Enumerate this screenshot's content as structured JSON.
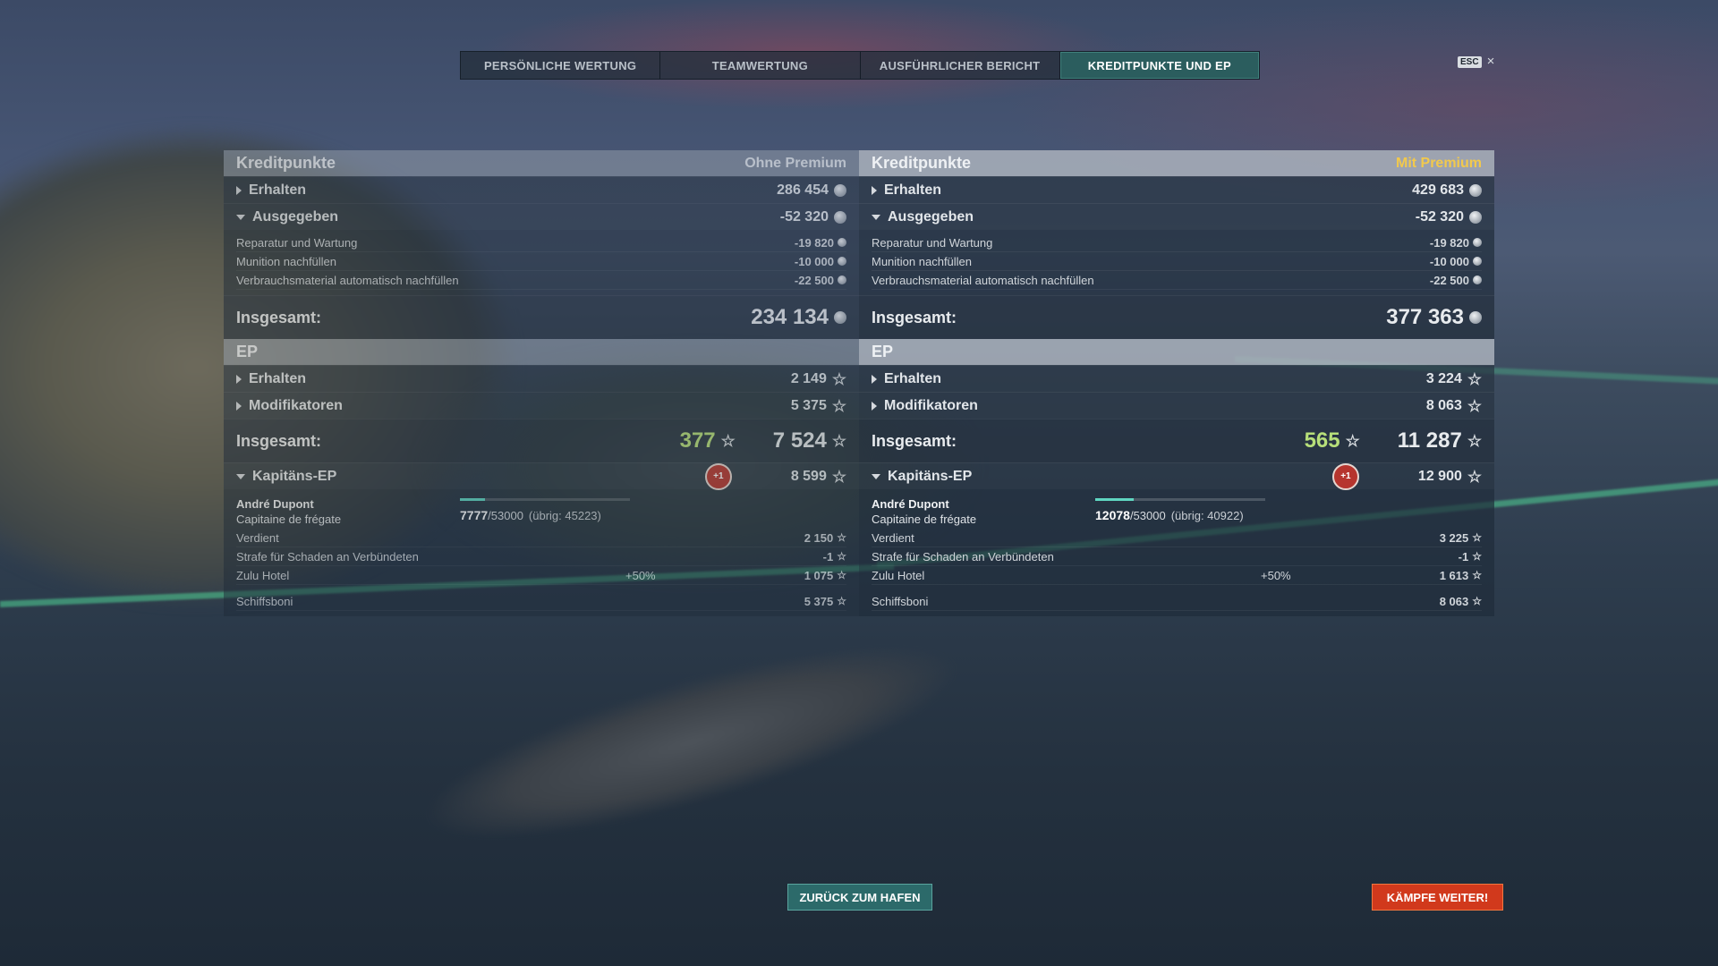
{
  "tabs": [
    {
      "label": "PERSÖNLICHE WERTUNG"
    },
    {
      "label": "TEAMWERTUNG"
    },
    {
      "label": "AUSFÜHRLICHER BERICHT"
    },
    {
      "label": "KREDITPUNKTE UND EP"
    }
  ],
  "esc": {
    "key": "ESC",
    "close": "×"
  },
  "left": {
    "credits_title": "Kreditpunkte",
    "premium_label": "Ohne Premium",
    "earned": {
      "label": "Erhalten",
      "value": "286 454"
    },
    "spent": {
      "label": "Ausgegeben",
      "value": "-52 320"
    },
    "spent_items": [
      {
        "label": "Reparatur und Wartung",
        "value": "-19 820"
      },
      {
        "label": "Munition nachfüllen",
        "value": "-10 000"
      },
      {
        "label": "Verbrauchsmaterial automatisch nachfüllen",
        "value": "-22 500"
      }
    ],
    "credits_total": {
      "label": "Insgesamt:",
      "value": "234 134"
    },
    "xp_title": "EP",
    "xp_earned": {
      "label": "Erhalten",
      "value": "2 149"
    },
    "xp_mods": {
      "label": "Modifikatoren",
      "value": "5 375"
    },
    "xp_total": {
      "label": "Insgesamt:",
      "free": "377",
      "value": "7 524"
    },
    "captain_xp": {
      "label": "Kapitäns-EP",
      "badge": "+1",
      "value": "8 599"
    },
    "captain": {
      "name": "André Dupont",
      "rank": "Capitaine de frégate",
      "progress_current": "7777",
      "progress_max": "/53000",
      "progress_rest": "(übrig: 45223)",
      "progress_fraction": 0.147
    },
    "captain_items": [
      {
        "label": "Verdient",
        "mid": "",
        "value": "2 150"
      },
      {
        "label": "Strafe für Schaden an Verbündeten",
        "mid": "",
        "value": "-1"
      },
      {
        "label": "Zulu Hotel",
        "mid": "+50%",
        "value": "1 075"
      }
    ],
    "ship_bonus": {
      "label": "Schiffsboni",
      "value": "5 375"
    }
  },
  "right": {
    "credits_title": "Kreditpunkte",
    "premium_label": "Mit Premium",
    "earned": {
      "label": "Erhalten",
      "value": "429 683"
    },
    "spent": {
      "label": "Ausgegeben",
      "value": "-52 320"
    },
    "spent_items": [
      {
        "label": "Reparatur und Wartung",
        "value": "-19 820"
      },
      {
        "label": "Munition nachfüllen",
        "value": "-10 000"
      },
      {
        "label": "Verbrauchsmaterial automatisch nachfüllen",
        "value": "-22 500"
      }
    ],
    "credits_total": {
      "label": "Insgesamt:",
      "value": "377 363"
    },
    "xp_title": "EP",
    "xp_earned": {
      "label": "Erhalten",
      "value": "3 224"
    },
    "xp_mods": {
      "label": "Modifikatoren",
      "value": "8 063"
    },
    "xp_total": {
      "label": "Insgesamt:",
      "free": "565",
      "value": "11 287"
    },
    "captain_xp": {
      "label": "Kapitäns-EP",
      "badge": "+1",
      "value": "12 900"
    },
    "captain": {
      "name": "André Dupont",
      "rank": "Capitaine de frégate",
      "progress_current": "12078",
      "progress_max": "/53000",
      "progress_rest": "(übrig: 40922)",
      "progress_fraction": 0.228
    },
    "captain_items": [
      {
        "label": "Verdient",
        "mid": "",
        "value": "3 225"
      },
      {
        "label": "Strafe für Schaden an Verbündeten",
        "mid": "",
        "value": "-1"
      },
      {
        "label": "Zulu Hotel",
        "mid": "+50%",
        "value": "1 613"
      }
    ],
    "ship_bonus": {
      "label": "Schiffsboni",
      "value": "8 063"
    }
  },
  "buttons": {
    "back": "ZURÜCK ZUM HAFEN",
    "fight": "KÄMPFE WEITER!"
  },
  "colors": {
    "accent": "#2b5d5e",
    "premium": "#f2c94c",
    "free_xp": "#b7df7a",
    "fight": "#d1391c"
  },
  "icons": {
    "credits": "coin-icon",
    "xp": "star-icon",
    "expand": "caret-icon",
    "bonus": "plus-one-badge"
  }
}
